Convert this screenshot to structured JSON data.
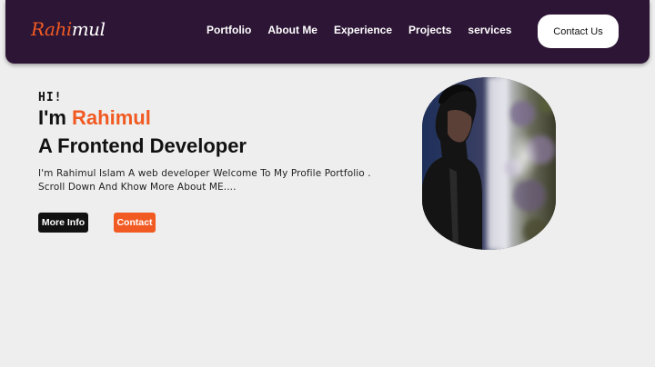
{
  "nav": {
    "logo_part1": "Rahi",
    "logo_part2": "mul",
    "links": [
      "Portfolio",
      "About Me",
      "Experience",
      "Projects",
      "services"
    ],
    "contact_label": "Contact Us"
  },
  "hero": {
    "greeting": "HI!",
    "name_prefix": "I'm ",
    "name": "Rahimul",
    "role": "A Frontend Developer",
    "intro": "I'm Rahimul Islam A web developer Welcome To My Profile Portfolio . Scroll Down And Khow More About ME....",
    "more_info_label": "More Info",
    "contact_label": "Contact"
  },
  "colors": {
    "nav_bg": "#2d1535",
    "accent": "#f15a22",
    "page_bg": "#eeeeee"
  }
}
